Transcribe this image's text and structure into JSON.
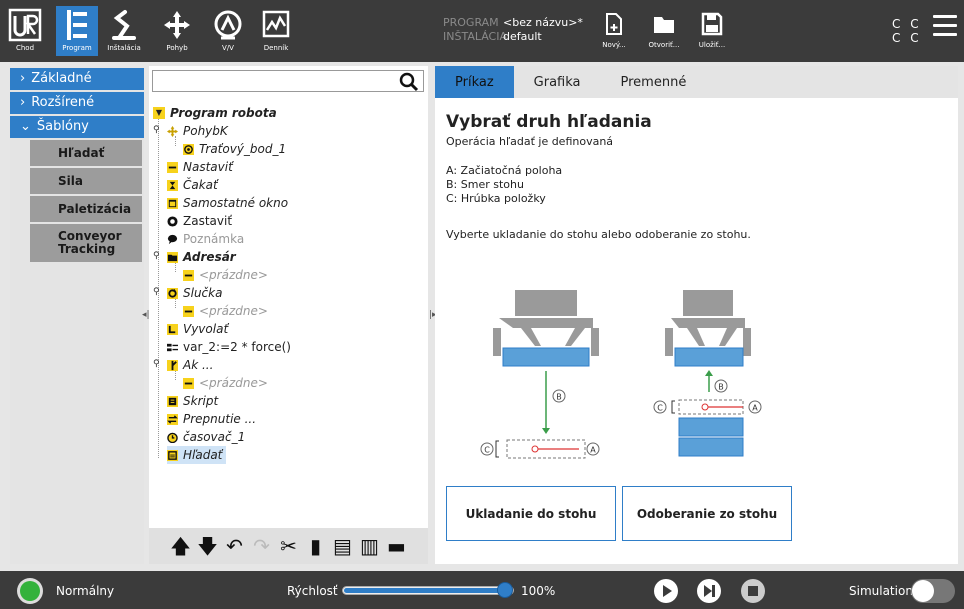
{
  "topbar": {
    "logo_sub": "Chod",
    "nav": [
      {
        "label": "Program",
        "icon": "program-icon"
      },
      {
        "label": "Inštalácia",
        "icon": "robot-arm-icon"
      },
      {
        "label": "Pohyb",
        "icon": "move-icon"
      },
      {
        "label": "V/V",
        "icon": "io-icon"
      },
      {
        "label": "Denník",
        "icon": "log-icon"
      }
    ],
    "program_key": "PROGRAM",
    "program_value": "<bez názvu>*",
    "installation_key": "INŠTALÁCIA",
    "installation_value": "default",
    "file_buttons": [
      {
        "label": "Nový...",
        "icon": "new-file-icon"
      },
      {
        "label": "Otvoriť...",
        "icon": "folder-icon"
      },
      {
        "label": "Uložiť...",
        "icon": "save-icon"
      }
    ],
    "cc_line1": "C C",
    "cc_line2": "C C"
  },
  "leftnav": {
    "categories": [
      {
        "label": "Základné",
        "chevron": "›"
      },
      {
        "label": "Rozšírené",
        "chevron": "›"
      },
      {
        "label": "Šablóny",
        "chevron": "⌄"
      }
    ],
    "templates": [
      "Hľadať",
      "Sila",
      "Paletizácia",
      "Conveyor Tracking"
    ]
  },
  "tree": {
    "search_placeholder": "",
    "nodes": [
      {
        "label": "Program robota"
      },
      {
        "label": "PohybK"
      },
      {
        "label": "Traťový_bod_1"
      },
      {
        "label": "Nastaviť"
      },
      {
        "label": "Čakať"
      },
      {
        "label": "Samostatné okno"
      },
      {
        "label": "Zastaviť"
      },
      {
        "label": "Poznámka"
      },
      {
        "label": "Adresár"
      },
      {
        "label": "<prázdne>"
      },
      {
        "label": "Slučka"
      },
      {
        "label": "<prázdne>"
      },
      {
        "label": "Vyvolať"
      },
      {
        "label": "var_2:=2 * force()"
      },
      {
        "label": "Ak ..."
      },
      {
        "label": "<prázdne>"
      },
      {
        "label": "Skript"
      },
      {
        "label": "Prepnutie ..."
      },
      {
        "label": "časovač_1"
      },
      {
        "label": "Hľadať"
      }
    ],
    "toolbar": [
      "move-up-icon",
      "move-down-icon",
      "undo-icon",
      "redo-icon",
      "cut-icon",
      "copy-icon",
      "paste-icon",
      "delete-icon",
      "suppress-icon"
    ]
  },
  "right": {
    "tabs": [
      "Príkaz",
      "Grafika",
      "Premenné"
    ],
    "title": "Vybrať druh hľadania",
    "subtitle": "Operácia hľadať je definovaná",
    "list": [
      "A: Začiatočná poloha",
      "B: Smer stohu",
      "C: Hrúbka položky"
    ],
    "instruction": "Vyberte ukladanie do stohu alebo odoberanie zo stohu.",
    "diagram_labels": {
      "a": "A",
      "b": "B",
      "c": "C"
    },
    "buttons": [
      "Ukladanie do stohu",
      "Odoberanie zo stohu"
    ]
  },
  "bottombar": {
    "status": "Normálny",
    "speed_label": "Rýchlosť",
    "speed_fraction": 1.0,
    "speed_value": "100%",
    "simulation_label": "Simulation",
    "simulation_on": false,
    "colors": {
      "accent": "#2f7ec8",
      "power_ok": "#33b23c",
      "yellow": "#f7d21c"
    }
  }
}
